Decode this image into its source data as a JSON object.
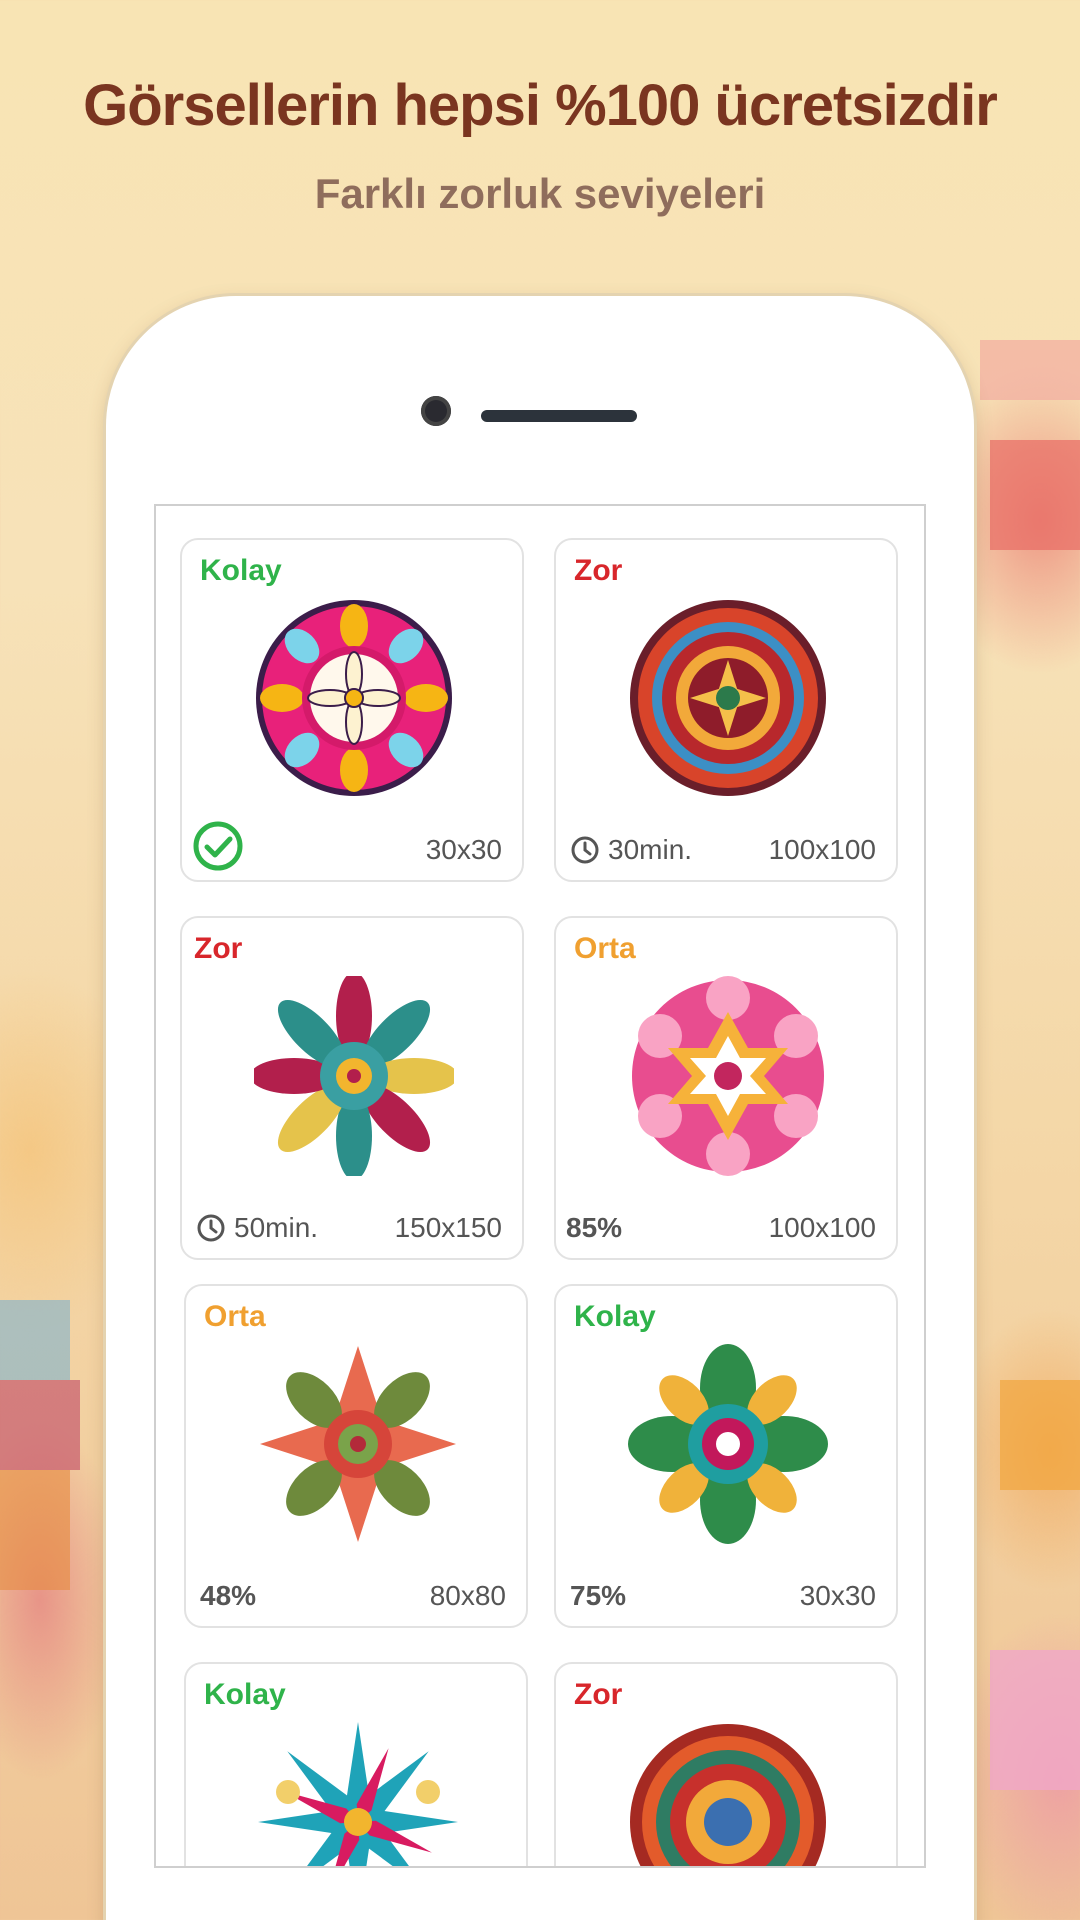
{
  "header": {
    "title": "Görsellerin hepsi %100 ücretsizdir",
    "subtitle": "Farklı zorluk seviyeleri"
  },
  "colors": {
    "easy": "#2fb34a",
    "medium": "#f0a030",
    "hard": "#d8262b",
    "title": "#7a3520",
    "subtitle": "#8f6d5c"
  },
  "cards": [
    {
      "difficulty": "Kolay",
      "level": "easy",
      "status": "completed",
      "meta": "",
      "size": "30x30",
      "art": "mandala-pink-flower-icon"
    },
    {
      "difficulty": "Zor",
      "level": "hard",
      "status": "time",
      "meta": "30min.",
      "size": "100x100",
      "art": "mandala-red-ornate-icon"
    },
    {
      "difficulty": "Zor",
      "level": "hard",
      "status": "time",
      "meta": "50min.",
      "size": "150x150",
      "art": "mandala-feather-swirl-icon"
    },
    {
      "difficulty": "Orta",
      "level": "medium",
      "status": "progress",
      "meta": "85%",
      "size": "100x100",
      "art": "mandala-pink-star-icon"
    },
    {
      "difficulty": "Orta",
      "level": "medium",
      "status": "progress",
      "meta": "48%",
      "size": "80x80",
      "art": "mandala-leaf-cross-icon"
    },
    {
      "difficulty": "Kolay",
      "level": "easy",
      "status": "progress",
      "meta": "75%",
      "size": "30x30",
      "art": "mandala-green-lotus-icon"
    },
    {
      "difficulty": "Kolay",
      "level": "easy",
      "status": "none",
      "meta": "",
      "size": "",
      "art": "mandala-blue-star-icon"
    },
    {
      "difficulty": "Zor",
      "level": "hard",
      "status": "none",
      "meta": "",
      "size": "",
      "art": "mandala-red-round-icon"
    }
  ]
}
